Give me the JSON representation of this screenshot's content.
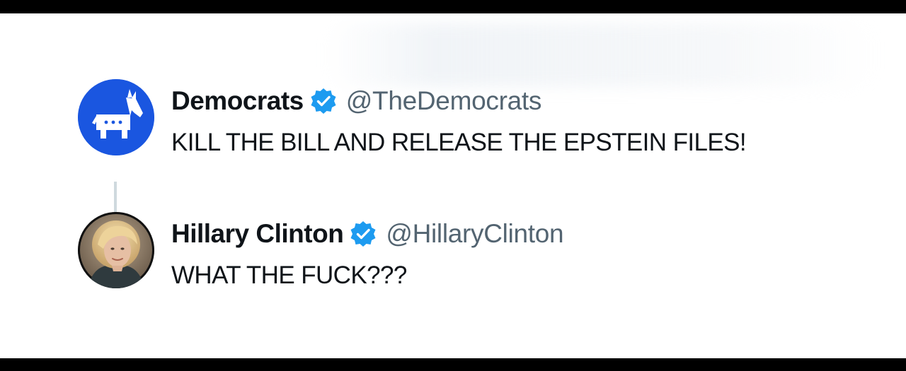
{
  "tweets": [
    {
      "display_name": "Democrats",
      "handle": "@TheDemocrats",
      "text": "KILL THE BILL AND RELEASE THE EPSTEIN FILES!",
      "avatar_icon": "donkey-logo-icon",
      "avatar_color": "#1a56e0",
      "verified": true
    },
    {
      "display_name": "Hillary Clinton",
      "handle": "@HillaryClinton",
      "text": "WHAT THE FUCK???",
      "avatar_icon": "portrait-photo",
      "verified": true
    }
  ],
  "colors": {
    "verified_blue": "#1d9bf0",
    "name_text": "#0f1419",
    "handle_text": "#536471",
    "thread_line": "#cfd9de",
    "letterbox": "#000000"
  }
}
